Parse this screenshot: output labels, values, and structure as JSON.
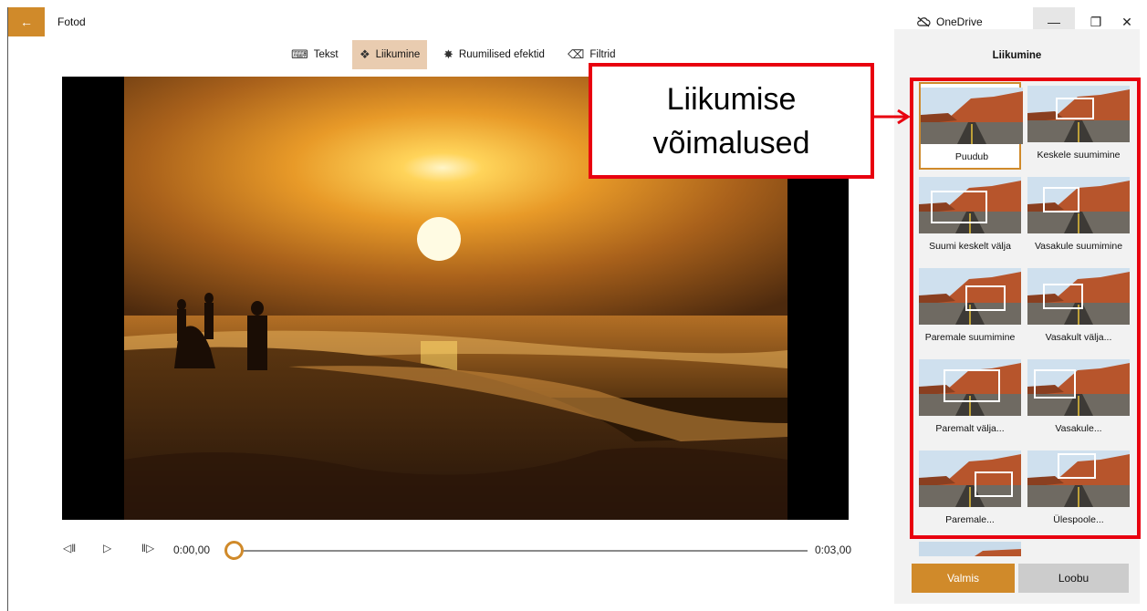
{
  "window": {
    "title": "Fotod",
    "onedrive_label": "OneDrive",
    "back_icon": "arrow-left-icon"
  },
  "toolbar": {
    "tools": [
      {
        "label": "Tekst",
        "icon": "text-icon"
      },
      {
        "label": "Liikumine",
        "icon": "motion-icon",
        "active": true
      },
      {
        "label": "Ruumilised efektid",
        "icon": "3d-effects-icon"
      },
      {
        "label": "Filtrid",
        "icon": "filter-icon"
      }
    ]
  },
  "playback": {
    "current_time": "0:00,00",
    "total_time": "0:03,00",
    "progress": 0
  },
  "panel": {
    "title": "Liikumine",
    "options": [
      {
        "label": "Puudub",
        "selected": true
      },
      {
        "label": "Keskele suumimine"
      },
      {
        "label": "Suumi keskelt välja"
      },
      {
        "label": "Vasakule suumimine"
      },
      {
        "label": "Paremale suumimine"
      },
      {
        "label": "Vasakult välja..."
      },
      {
        "label": "Paremalt välja..."
      },
      {
        "label": "Vasakule..."
      },
      {
        "label": "Paremale..."
      },
      {
        "label": "Ülespoole..."
      }
    ],
    "done_label": "Valmis",
    "cancel_label": "Loobu"
  },
  "annotation": {
    "line1": "Liikumise",
    "line2": "võimalused"
  },
  "colors": {
    "accent": "#d08a2a",
    "annotation": "#e8000f"
  }
}
